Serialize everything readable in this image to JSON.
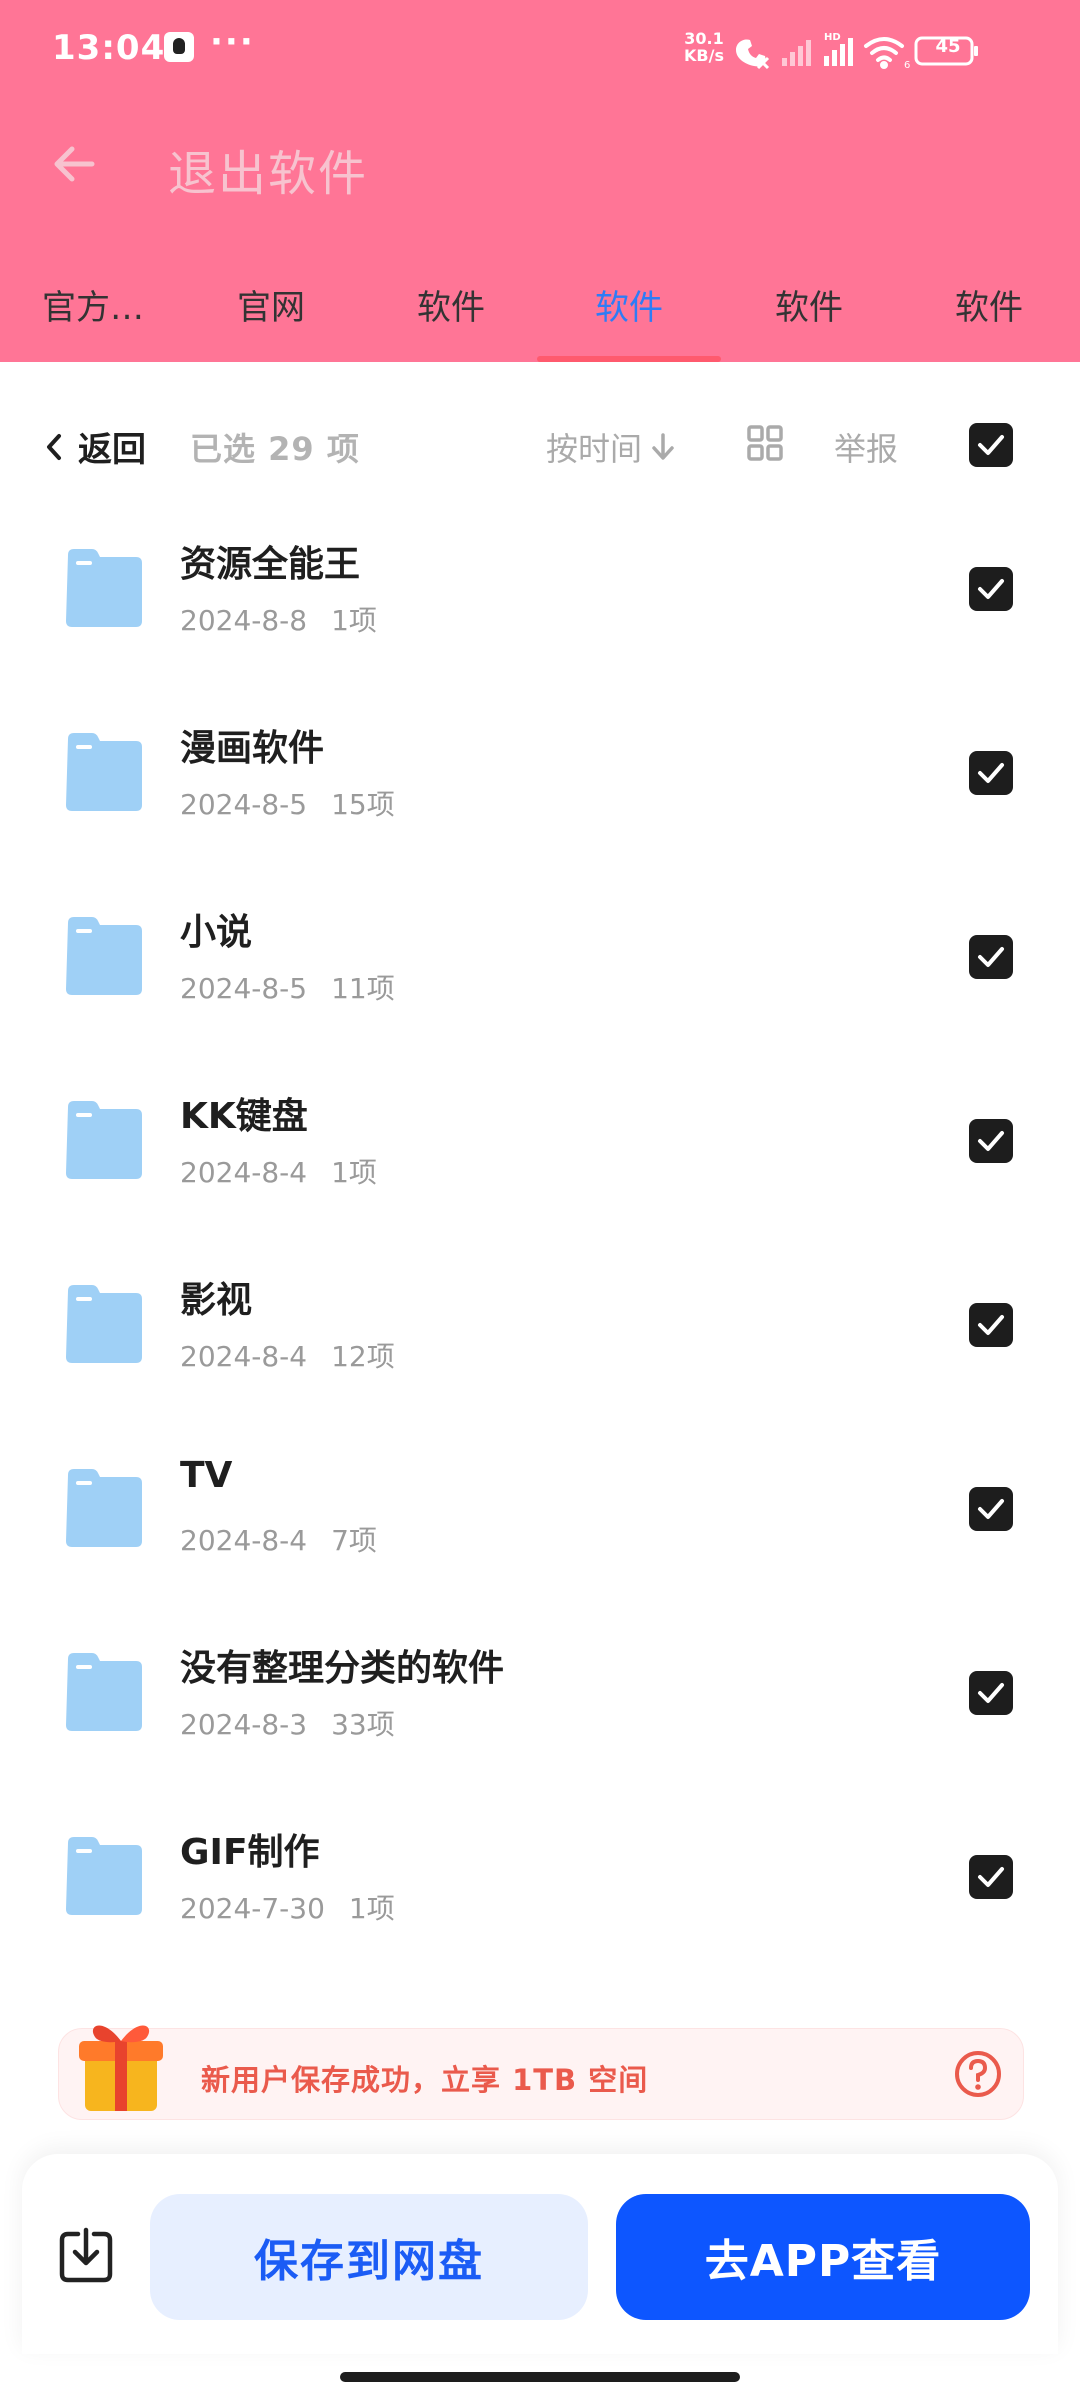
{
  "status_bar": {
    "time": "13:04",
    "dots": "···",
    "speed_value": "30.1",
    "speed_unit": "KB/s",
    "battery": "45"
  },
  "header": {
    "title": "退出软件",
    "tabs": [
      {
        "label": "官方…"
      },
      {
        "label": "官网"
      },
      {
        "label": "软件"
      },
      {
        "label": "软件"
      },
      {
        "label": "软件"
      },
      {
        "label": "软件"
      }
    ],
    "active_tab_index": 3
  },
  "toolbar": {
    "back_label": "返回",
    "selected_label": "已选 29 项",
    "sort_label": "按时间",
    "report_label": "举报"
  },
  "files": [
    {
      "name": "资源全能王",
      "date": "2024-8-8",
      "count": "1项",
      "checked": true
    },
    {
      "name": "漫画软件",
      "date": "2024-8-5",
      "count": "15项",
      "checked": true
    },
    {
      "name": "小说",
      "date": "2024-8-5",
      "count": "11项",
      "checked": true
    },
    {
      "name": "KK键盘",
      "date": "2024-8-4",
      "count": "1项",
      "checked": true
    },
    {
      "name": "影视",
      "date": "2024-8-4",
      "count": "12项",
      "checked": true
    },
    {
      "name": "TV",
      "date": "2024-8-4",
      "count": "7项",
      "checked": true
    },
    {
      "name": "没有整理分类的软件",
      "date": "2024-8-3",
      "count": "33项",
      "checked": true
    },
    {
      "name": "GIF制作",
      "date": "2024-7-30",
      "count": "1项",
      "checked": true
    }
  ],
  "promo": {
    "text": "新用户保存成功，立享 1TB 空间"
  },
  "bottom_bar": {
    "save_label": "保存到网盘",
    "open_label": "去APP查看"
  },
  "colors": {
    "header_bg": "#ff7596",
    "active_tab": "#2e7cf6",
    "tab_underline": "#ff5a6e",
    "primary_button": "#0d56ff",
    "secondary_button_bg": "#e7efff",
    "folder_blue": "#9fd0f6",
    "promo_text": "#ea5a4c"
  },
  "icons": {
    "back": "arrow-left-icon",
    "folder": "folder-icon",
    "check": "checkmark-icon",
    "grid": "grid-view-icon",
    "sort": "arrow-down-icon",
    "gift": "gift-icon",
    "help": "question-circle-icon",
    "download": "download-icon"
  }
}
